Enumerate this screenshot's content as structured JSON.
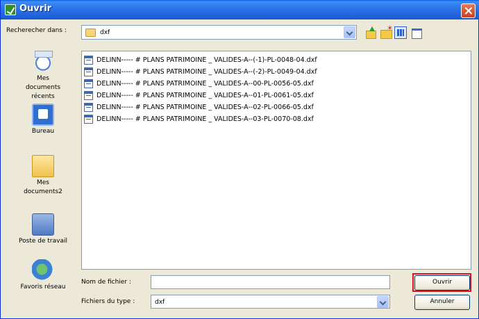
{
  "window": {
    "title": "Ouvrir",
    "accent": "#0a5fe0",
    "close_icon": "close-icon"
  },
  "lookin": {
    "label": "Recherecher dans :",
    "value": "dxf"
  },
  "toolbar": {
    "icons": [
      "up-folder-icon",
      "new-folder-icon",
      "view-menu-icon",
      "details-view-icon"
    ]
  },
  "places": [
    {
      "label": "Mes documents récents",
      "lines": [
        "Mes",
        "documents",
        "récents"
      ],
      "icon": "recent-documents-icon"
    },
    {
      "label": "Bureau",
      "lines": [
        "Bureau"
      ],
      "icon": "desktop-icon"
    },
    {
      "label": "Mes documents2",
      "lines": [
        "Mes",
        "documents2"
      ],
      "icon": "my-documents-icon"
    },
    {
      "label": "Poste de travail",
      "lines": [
        "Poste de travail"
      ],
      "icon": "my-computer-icon"
    },
    {
      "label": "Favoris réseau",
      "lines": [
        "Favoris réseau"
      ],
      "icon": "network-icon"
    }
  ],
  "files": [
    "DELINN----- # PLANS PATRIMOINE _ VALIDES-A--(-1)-PL-0048-04.dxf",
    "DELINN----- # PLANS PATRIMOINE _ VALIDES-A--(-2)-PL-0049-04.dxf",
    "DELINN----- # PLANS PATRIMOINE _ VALIDES-A--00-PL-0056-05.dxf",
    "DELINN----- # PLANS PATRIMOINE _ VALIDES-A--01-PL-0061-05.dxf",
    "DELINN----- # PLANS PATRIMOINE _ VALIDES-A--02-PL-0066-05.dxf",
    "DELINN----- # PLANS PATRIMOINE _ VALIDES-A--03-PL-0070-08.dxf"
  ],
  "filename": {
    "label": "Nom de fichier :",
    "value": ""
  },
  "filetype": {
    "label": "Fichiers du type :",
    "value": "dxf"
  },
  "buttons": {
    "open": "Ouvrir",
    "cancel": "Annuler",
    "highlight_color": "#e0141e"
  }
}
